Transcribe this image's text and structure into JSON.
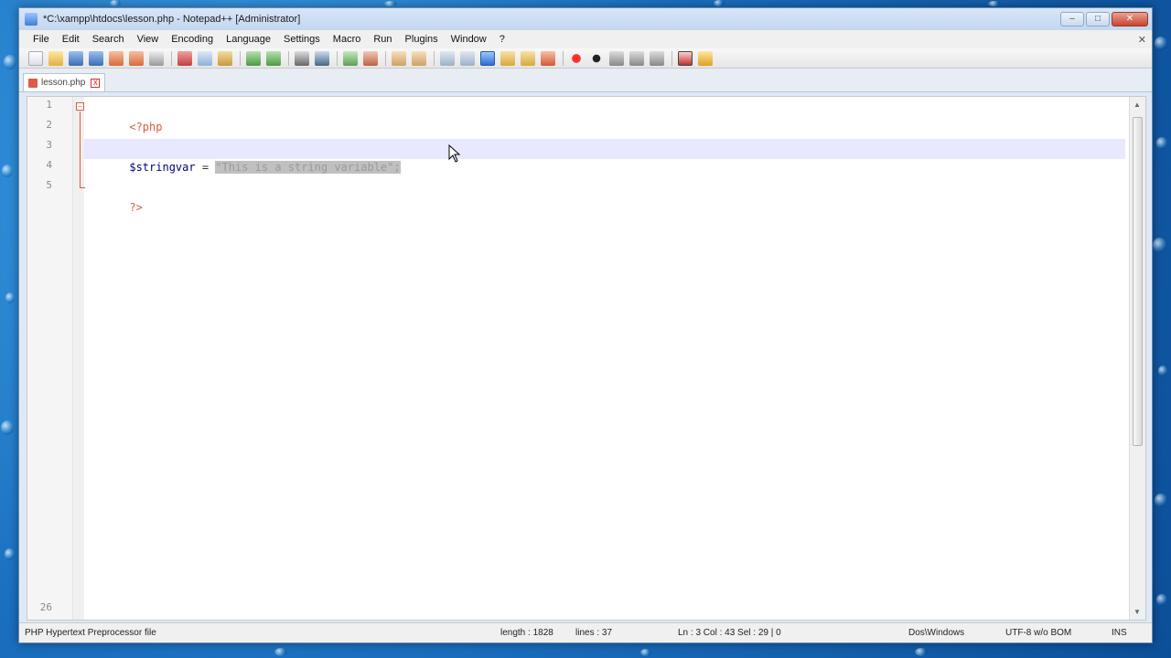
{
  "window": {
    "title": "*C:\\xampp\\htdocs\\lesson.php - Notepad++ [Administrator]"
  },
  "menu": [
    "File",
    "Edit",
    "Search",
    "View",
    "Encoding",
    "Language",
    "Settings",
    "Macro",
    "Run",
    "Plugins",
    "Window",
    "?"
  ],
  "tabs": [
    {
      "label": "lesson.php",
      "active": true
    }
  ],
  "editor": {
    "lines": [
      {
        "num": "1",
        "text": "<?php"
      },
      {
        "num": "2",
        "text": ""
      },
      {
        "num": "3",
        "var": "$stringvar",
        "op": " = ",
        "selected": "\"This is a string variable\";"
      },
      {
        "num": "4",
        "text": ""
      },
      {
        "num": "5",
        "text": "?>"
      }
    ],
    "bottom_line_num": "26"
  },
  "status": {
    "file_type": "PHP Hypertext Preprocessor file",
    "length": "length : 1828",
    "lines": "lines : 37",
    "position": "Ln : 3    Col : 43    Sel : 29 | 0",
    "eol": "Dos\\Windows",
    "encoding": "UTF-8 w/o BOM",
    "mode": "INS"
  },
  "icons": [
    "app-icon",
    "file-icon",
    "close-icon",
    "minimize-icon",
    "maximize-icon",
    "mouse-pointer-icon"
  ]
}
